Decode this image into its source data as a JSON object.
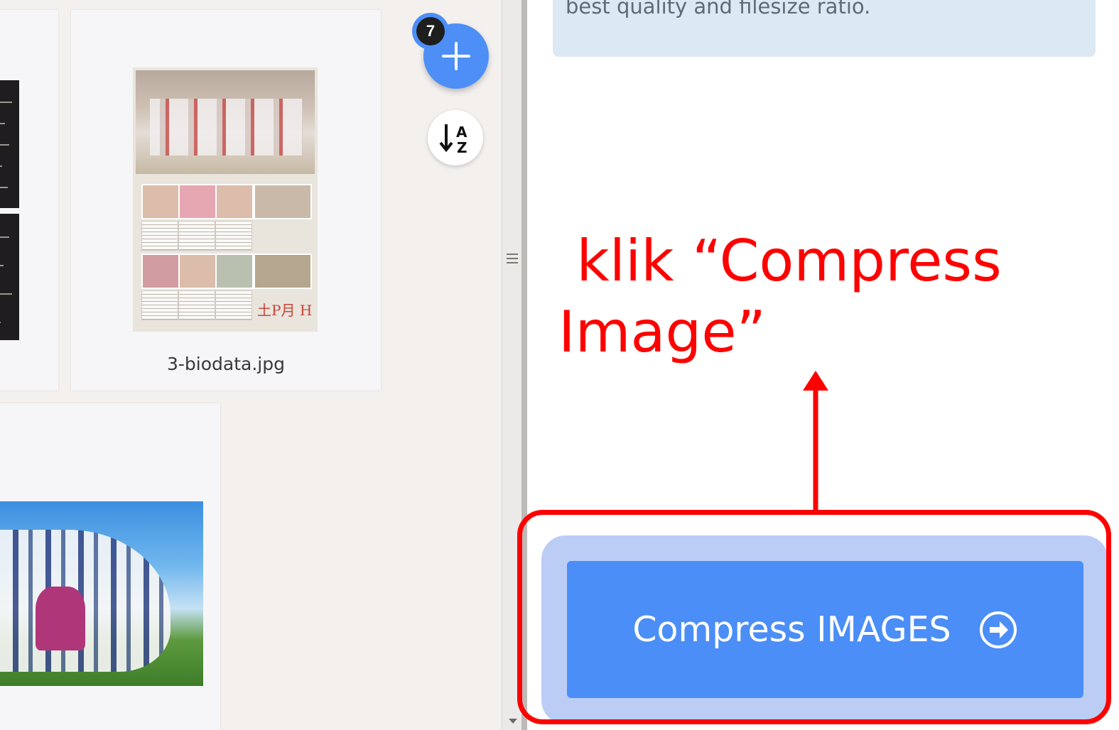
{
  "files": {
    "items": [
      {
        "name": ""
      },
      {
        "name": "3-biodata.jpg"
      },
      {
        "name": ""
      }
    ]
  },
  "fab": {
    "add_icon": "plus-icon",
    "file_count": "7",
    "sort_icon": "sort-az-icon"
  },
  "sidebar": {
    "info_text": "best quality and filesize ratio."
  },
  "annotation": {
    "text": " klik “Compress\nImage”",
    "color": "#ff0000"
  },
  "compress_button": {
    "label": "Compress IMAGES",
    "icon": "arrow-circle-right-icon",
    "color": "#4b8ef7"
  }
}
